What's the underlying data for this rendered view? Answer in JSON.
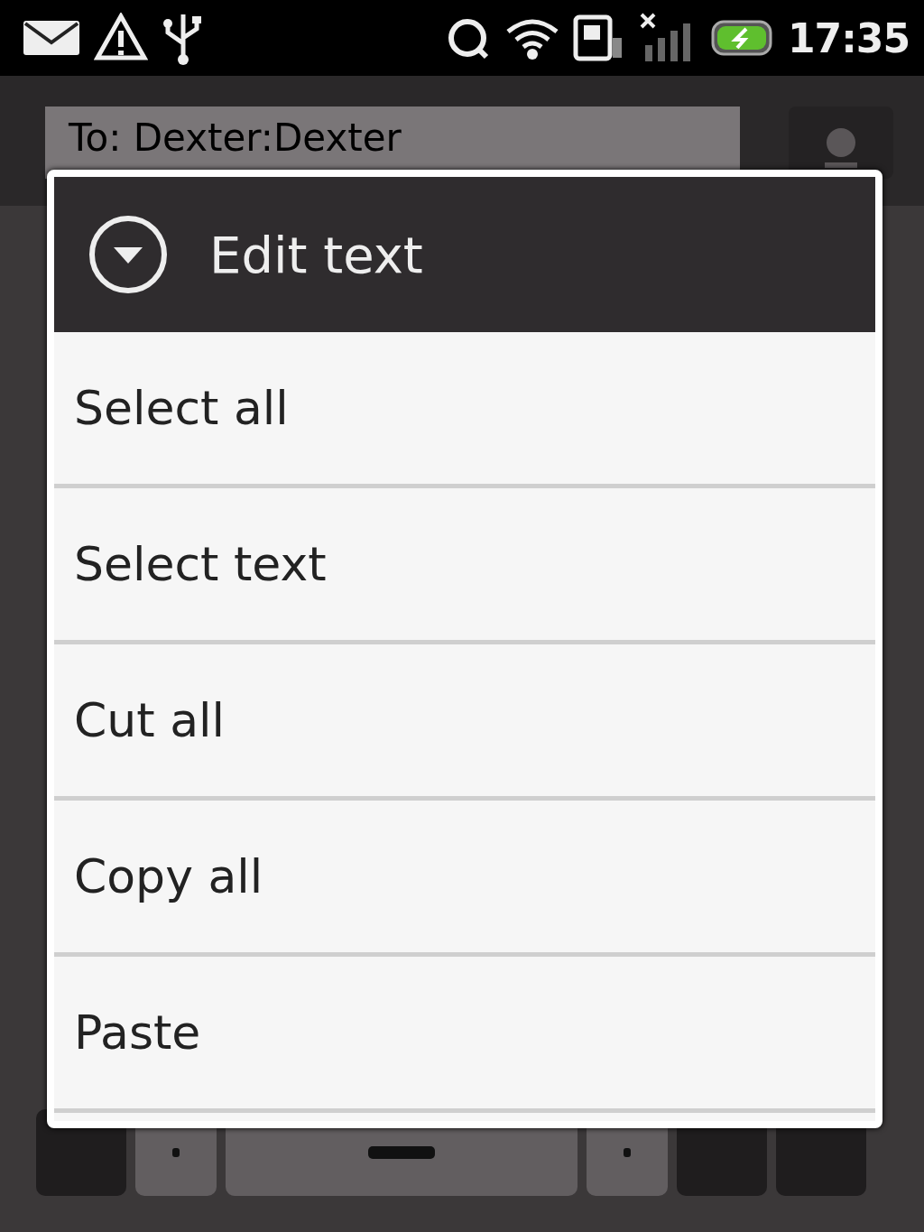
{
  "status_bar": {
    "time": "17:35"
  },
  "compose": {
    "recipient": "To: Dexter:Dexter"
  },
  "dialog": {
    "title": "Edit text",
    "items": [
      {
        "label": "Select all"
      },
      {
        "label": "Select text"
      },
      {
        "label": "Cut all"
      },
      {
        "label": "Copy all"
      },
      {
        "label": "Paste"
      }
    ]
  }
}
